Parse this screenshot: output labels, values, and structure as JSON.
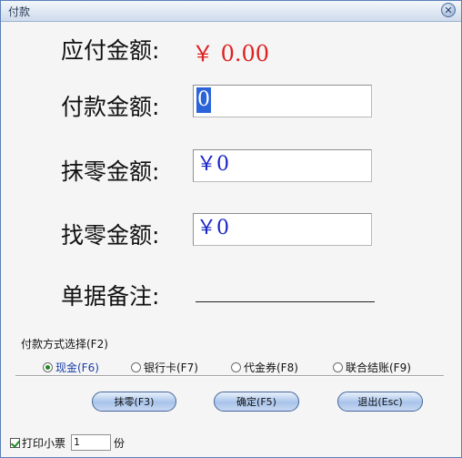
{
  "window": {
    "title": "付款",
    "close_icon": "close-icon"
  },
  "form": {
    "due_label": "应付金额:",
    "due_value": "￥  0.00",
    "paid_label": "付款金额:",
    "paid_value": "0",
    "rounding_label": "抹零金额:",
    "rounding_value": "￥0",
    "change_label": "找零金额:",
    "change_value": "￥0",
    "note_label": "单据备注:",
    "note_value": ""
  },
  "payment": {
    "group_label": "付款方式选择(F2)",
    "options": [
      {
        "label": "现金(F6)",
        "selected": true
      },
      {
        "label": "银行卡(F7)",
        "selected": false
      },
      {
        "label": "代金券(F8)",
        "selected": false
      },
      {
        "label": "联合结账(F9)",
        "selected": false
      }
    ]
  },
  "buttons": {
    "rounding": "抹零(F3)",
    "confirm": "确定(F5)",
    "exit": "退出(Esc)"
  },
  "print": {
    "label": "打印小票",
    "checked": true,
    "copies": "1",
    "copies_unit": "份"
  },
  "colors": {
    "due_value": "#e02020",
    "field_text": "#1a25c8",
    "selection": "#2b63d9"
  }
}
